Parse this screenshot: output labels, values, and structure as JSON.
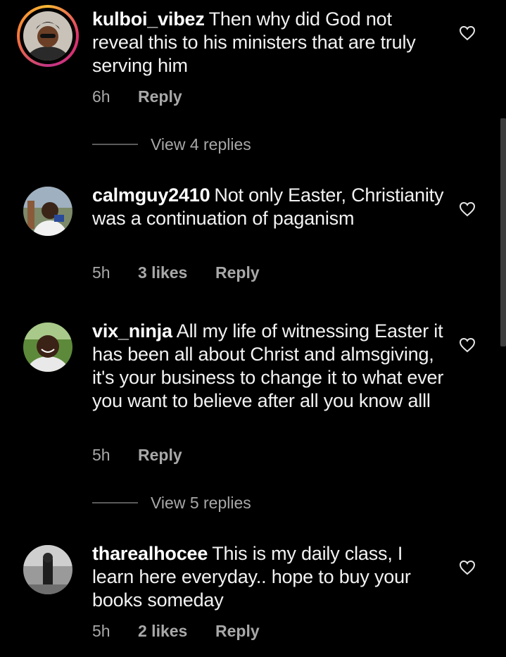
{
  "comments": [
    {
      "username": "kulboi_vibez",
      "text": "Then why did God not reveal this to his ministers that are truly serving him",
      "time": "6h",
      "likes": "",
      "reply": "Reply",
      "view_replies": "View 4 replies"
    },
    {
      "username": "calmguy2410",
      "text": "Not only Easter, Christianity was a continuation of paganism",
      "time": "5h",
      "likes": "3 likes",
      "reply": "Reply"
    },
    {
      "username": "vix_ninja",
      "text": "All my life of witnessing Easter it has been all about Christ and almsgiving, it's your business to change it to what ever you want to believe after all you know alll",
      "time": "5h",
      "likes": "",
      "reply": "Reply",
      "view_replies": "View 5 replies"
    },
    {
      "username": "tharealhocee",
      "text": "This is my daily class, I learn here everyday.. hope to buy your books someday",
      "time": "5h",
      "likes": "2 likes",
      "reply": "Reply"
    }
  ],
  "icons": {
    "like": "heart-outline-icon"
  },
  "colors": {
    "background": "#000000",
    "text": "#f2f2f2",
    "muted": "#a8a8a8",
    "story_ring": "#e1306c"
  }
}
